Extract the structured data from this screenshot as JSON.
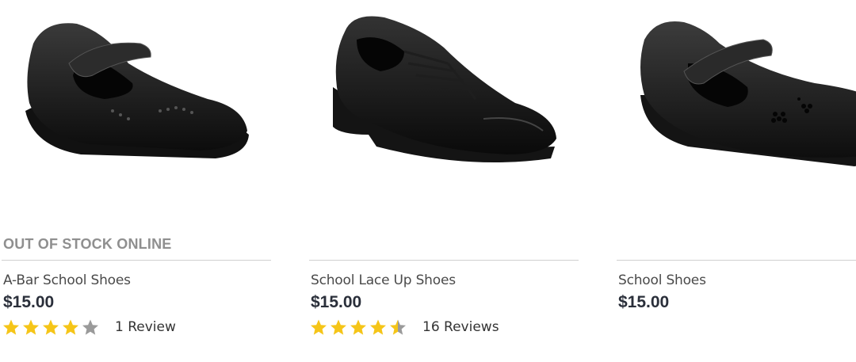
{
  "products": [
    {
      "stock_status": "OUT OF STOCK ONLINE",
      "name": "A-Bar School Shoes",
      "price": "$15.00",
      "rating": 4,
      "reviews": "1 Review",
      "image": "black-mary-jane-school-shoe"
    },
    {
      "stock_status": "",
      "name": "School Lace Up Shoes",
      "price": "$15.00",
      "rating": 4.5,
      "reviews": "16 Reviews",
      "image": "black-lace-up-school-shoe"
    },
    {
      "stock_status": "",
      "name": "School Shoes",
      "price": "$15.00",
      "rating": null,
      "reviews": "",
      "image": "black-t-bar-school-shoe"
    }
  ],
  "colors": {
    "star_filled": "#f5c518",
    "star_empty": "#9a9a9a",
    "stock_text": "#8f8f8f",
    "price_text": "#2a2f3a"
  }
}
